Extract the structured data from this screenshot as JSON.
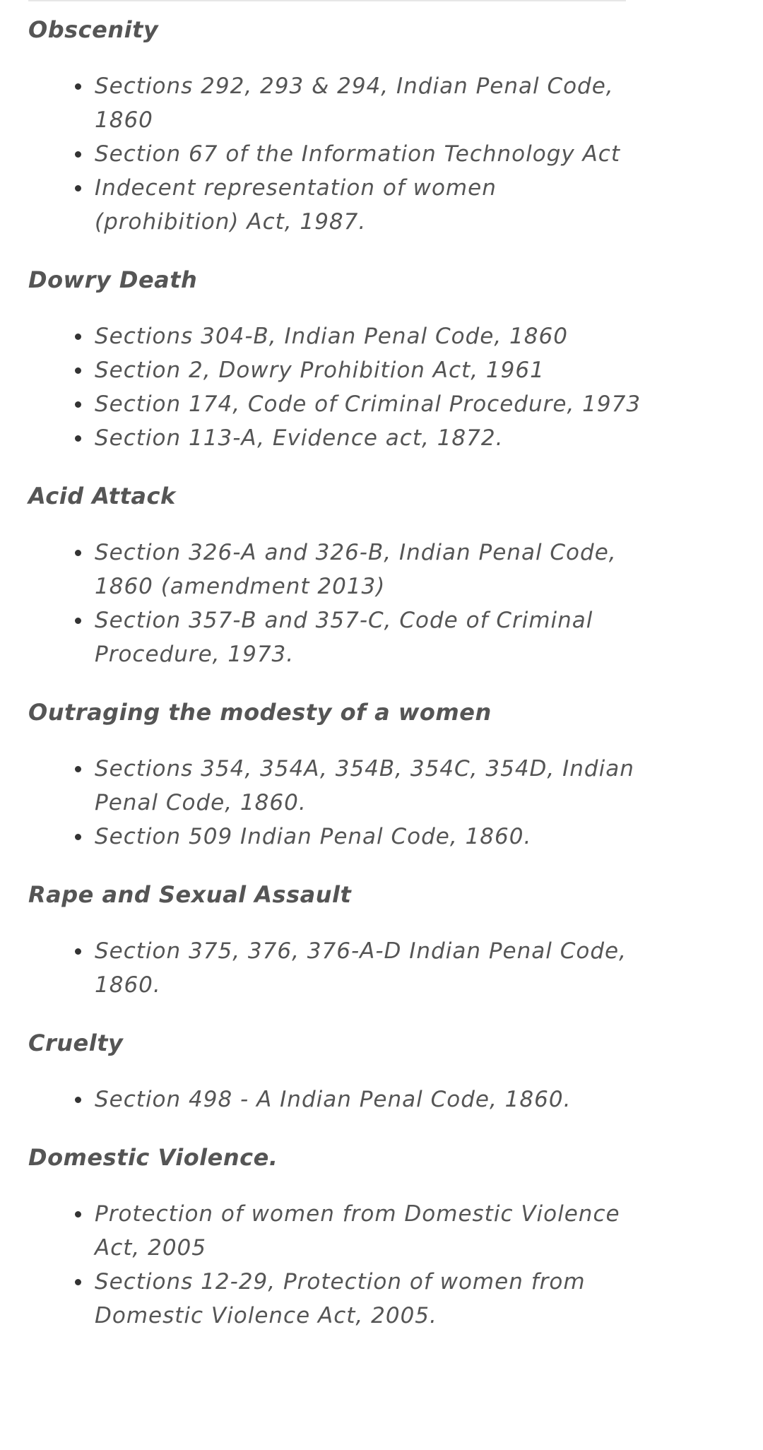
{
  "sections": [
    {
      "heading": "Obscenity",
      "items": [
        "Sections 292, 293 & 294, Indian Penal Code, 1860",
        "Section 67 of the Information Technology Act",
        "Indecent representation of women (prohibition) Act, 1987."
      ]
    },
    {
      "heading": "Dowry Death",
      "items": [
        "Sections 304-B, Indian Penal Code, 1860",
        "Section 2, Dowry Prohibition Act, 1961",
        "Section 174, Code of Criminal Procedure, 1973",
        "Section 113-A, Evidence act, 1872."
      ]
    },
    {
      "heading": "Acid Attack",
      "items": [
        "Section 326-A and 326-B, Indian Penal Code, 1860 (amendment 2013)",
        "Section 357-B and 357-C, Code of Criminal Procedure, 1973."
      ]
    },
    {
      "heading": "Outraging the modesty of a women",
      "items": [
        "Sections 354, 354A, 354B, 354C, 354D, Indian Penal Code, 1860.",
        "Section 509 Indian Penal Code, 1860."
      ]
    },
    {
      "heading": "Rape and Sexual Assault",
      "items": [
        "Section 375, 376, 376-A-D Indian Penal Code, 1860."
      ]
    },
    {
      "heading": "Cruelty",
      "items": [
        "Section 498 - A Indian Penal Code, 1860."
      ]
    },
    {
      "heading": "Domestic Violence.",
      "items": [
        "Protection of women from Domestic Violence Act, 2005",
        "Sections 12-29, Protection of women from Domestic Violence Act, 2005."
      ]
    }
  ]
}
